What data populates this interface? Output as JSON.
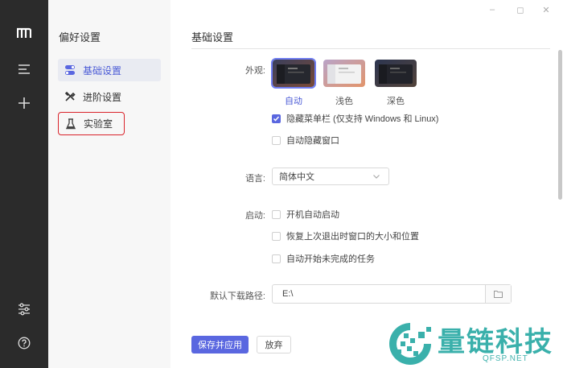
{
  "window": {
    "minimize": "‒",
    "restore": "◻",
    "close": "✕"
  },
  "rail": {
    "icons": [
      "logo-icon",
      "menu-icon",
      "plus-icon",
      "sliders-icon",
      "help-icon"
    ]
  },
  "sidebar": {
    "title": "偏好设置",
    "items": [
      {
        "label": "基础设置",
        "icon": "toggle-icon",
        "active": true
      },
      {
        "label": "进阶设置",
        "icon": "tools-icon",
        "active": false
      },
      {
        "label": "实验室",
        "icon": "flask-icon",
        "active": false
      }
    ]
  },
  "main": {
    "heading": "基础设置",
    "appearance": {
      "label": "外观:",
      "themes": [
        {
          "label": "自动",
          "selected": true
        },
        {
          "label": "浅色",
          "selected": false
        },
        {
          "label": "深色",
          "selected": false
        }
      ],
      "options": [
        {
          "label": "隐藏菜单栏 (仅支持 Windows 和 Linux)",
          "checked": true
        },
        {
          "label": "自动隐藏窗口",
          "checked": false
        }
      ]
    },
    "language": {
      "label": "语言:",
      "value": "简体中文"
    },
    "startup": {
      "label": "启动:",
      "options": [
        {
          "label": "开机自动启动",
          "checked": false
        },
        {
          "label": "恢复上次退出时窗口的大小和位置",
          "checked": false
        },
        {
          "label": "自动开始未完成的任务",
          "checked": false
        }
      ]
    },
    "download_path": {
      "label": "默认下载路径:",
      "value": "E:\\"
    },
    "buttons": {
      "save": "保存并应用",
      "discard": "放弃"
    }
  },
  "watermark": {
    "text": "量链科技",
    "sub": "QFSP.NET"
  },
  "colors": {
    "accent": "#5a67e0",
    "rail": "#2b2b2b",
    "highlight": "#d9232b",
    "watermark": "#1fa6a0"
  }
}
